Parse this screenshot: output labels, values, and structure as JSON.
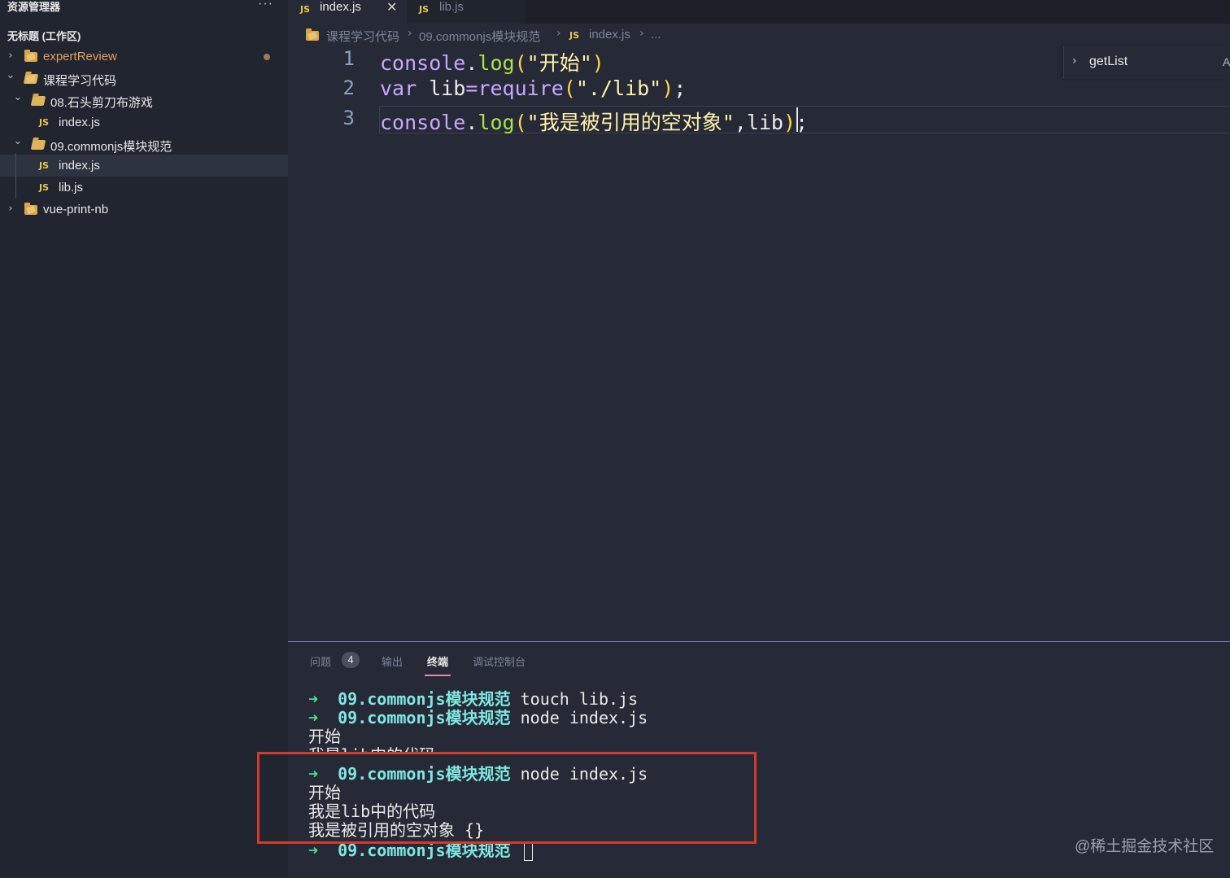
{
  "sidebar": {
    "title": "资源管理器",
    "more": "···",
    "workspace_title": "无标题 (工作区)",
    "items": [
      {
        "label": "expertReview",
        "chevron": "›",
        "type": "folder"
      },
      {
        "label": "课程学习代码",
        "chevron": "⌄",
        "type": "folder"
      },
      {
        "label": "08.石头剪刀布游戏",
        "chevron": "⌄",
        "type": "folder"
      },
      {
        "label": "index.js",
        "icon": "JS",
        "type": "file"
      },
      {
        "label": "09.commonjs模块规范",
        "chevron": "⌄",
        "type": "folder"
      },
      {
        "label": "index.js",
        "icon": "JS",
        "type": "file",
        "selected": true
      },
      {
        "label": "lib.js",
        "icon": "JS",
        "type": "file"
      },
      {
        "label": "vue-print-nb",
        "chevron": "›",
        "type": "folder"
      }
    ]
  },
  "tabs": [
    {
      "icon": "JS",
      "label": "index.js",
      "close": "✕",
      "active": true
    },
    {
      "icon": "JS",
      "label": "lib.js",
      "active": false
    }
  ],
  "breadcrumb": {
    "parts": [
      "课程学习代码",
      "09.commonjs模块规范",
      "index.js",
      "..."
    ],
    "sep": "›",
    "js_icon": "JS"
  },
  "code": {
    "line_numbers": [
      "1",
      "2",
      "3"
    ],
    "line1": {
      "obj": "console",
      "dot": ".",
      "fn": "log",
      "open": "(",
      "str": "\"开始\"",
      "close": ")"
    },
    "line2": {
      "kw": "var",
      "name": " lib",
      "eq": "=",
      "req": "require",
      "open": "(",
      "str": "\"./lib\"",
      "close": ")",
      "semi": ";"
    },
    "line3": {
      "obj": "console",
      "dot": ".",
      "fn": "log",
      "open": "(",
      "str": "\"我是被引用的空对象\"",
      "comma": ",",
      "arg": "lib",
      "close": ")",
      "semi": ";"
    }
  },
  "outline": {
    "chevron": "›",
    "label": "getList",
    "extra": "A"
  },
  "panel": {
    "tabs": [
      "问题",
      "输出",
      "终端",
      "调试控制台"
    ],
    "problems_count": "4",
    "active_tab": "终端"
  },
  "terminal": {
    "arrow": "➜",
    "dir": "09.commonjs模块规范",
    "lines": [
      {
        "type": "prompt",
        "cmd": "touch lib.js"
      },
      {
        "type": "prompt",
        "cmd": "node index.js"
      },
      {
        "type": "out",
        "text": "开始"
      },
      {
        "type": "out",
        "text": "我是lib中的代码"
      },
      {
        "type": "prompt",
        "cmd": "node index.js"
      },
      {
        "type": "out",
        "text": "开始"
      },
      {
        "type": "out",
        "text": "我是lib中的代码"
      },
      {
        "type": "out",
        "text": "我是被引用的空对象 {}"
      },
      {
        "type": "prompt",
        "cmd": ""
      }
    ]
  },
  "watermark": "@稀土掘金技术社区",
  "colors": {
    "accent": "#7a7dc8",
    "highlight_box": "#d43a2a",
    "js_icon": "#e8c84a"
  }
}
